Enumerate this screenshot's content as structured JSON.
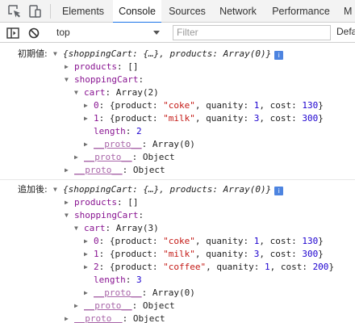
{
  "tabs": [
    "Elements",
    "Console",
    "Sources",
    "Network",
    "Performance",
    "M"
  ],
  "toolbar": {
    "context": "top",
    "filter_placeholder": "Filter",
    "levels": "Defa"
  },
  "icons": {
    "inspect": "inspect-element-icon",
    "device": "device-toolbar-icon",
    "sidebar": "console-sidebar-icon",
    "clear": "clear-console-icon",
    "info": "info-icon"
  },
  "log": [
    {
      "label": "初期値:",
      "lines": [
        {
          "t": "▼",
          "p": [
            [
              "sum",
              "{shoppingCart: {…}, products: Array(0)}"
            ]
          ]
        },
        {
          "t": "▶",
          "p": [
            [
              "key",
              "products"
            ],
            [
              "",
              ": []"
            ]
          ]
        },
        {
          "t": "▼",
          "p": [
            [
              "key",
              "shoppingCart"
            ],
            [
              "",
              ":"
            ]
          ]
        },
        {
          "t": "▼",
          "p": [
            [
              "key",
              "cart"
            ],
            [
              "",
              ": Array(2)"
            ]
          ]
        },
        {
          "t": "▶",
          "p": [
            [
              "key",
              "0"
            ],
            [
              "",
              ": {product: "
            ],
            [
              "str",
              "\"coke\""
            ],
            [
              "",
              ", quanity: "
            ],
            [
              "num",
              "1"
            ],
            [
              "",
              ", cost: "
            ],
            [
              "num",
              "130"
            ],
            [
              "",
              "}"
            ]
          ]
        },
        {
          "t": "▶",
          "p": [
            [
              "key",
              "1"
            ],
            [
              "",
              ": {product: "
            ],
            [
              "str",
              "\"milk\""
            ],
            [
              "",
              ", quanity: "
            ],
            [
              "num",
              "3"
            ],
            [
              "",
              ", cost: "
            ],
            [
              "num",
              "300"
            ],
            [
              "",
              "}"
            ]
          ]
        },
        {
          "t": "",
          "p": [
            [
              "key",
              "length"
            ],
            [
              "",
              ": "
            ],
            [
              "num",
              "2"
            ]
          ]
        },
        {
          "t": "▶",
          "p": [
            [
              "proto",
              "__proto__"
            ],
            [
              "",
              ": Array(0)"
            ]
          ]
        },
        {
          "t": "▶",
          "p": [
            [
              "proto",
              "__proto__"
            ],
            [
              "",
              ": Object"
            ]
          ]
        },
        {
          "t": "▶",
          "p": [
            [
              "proto",
              "__proto__"
            ],
            [
              "",
              ": Object"
            ]
          ]
        }
      ]
    },
    {
      "label": "追加後:",
      "lines": [
        {
          "t": "▼",
          "p": [
            [
              "sum",
              "{shoppingCart: {…}, products: Array(0)}"
            ]
          ]
        },
        {
          "t": "▶",
          "p": [
            [
              "key",
              "products"
            ],
            [
              "",
              ": []"
            ]
          ]
        },
        {
          "t": "▼",
          "p": [
            [
              "key",
              "shoppingCart"
            ],
            [
              "",
              ":"
            ]
          ]
        },
        {
          "t": "▼",
          "p": [
            [
              "key",
              "cart"
            ],
            [
              "",
              ": Array(3)"
            ]
          ]
        },
        {
          "t": "▶",
          "p": [
            [
              "key",
              "0"
            ],
            [
              "",
              ": {product: "
            ],
            [
              "str",
              "\"coke\""
            ],
            [
              "",
              ", quanity: "
            ],
            [
              "num",
              "1"
            ],
            [
              "",
              ", cost: "
            ],
            [
              "num",
              "130"
            ],
            [
              "",
              "}"
            ]
          ]
        },
        {
          "t": "▶",
          "p": [
            [
              "key",
              "1"
            ],
            [
              "",
              ": {product: "
            ],
            [
              "str",
              "\"milk\""
            ],
            [
              "",
              ", quanity: "
            ],
            [
              "num",
              "3"
            ],
            [
              "",
              ", cost: "
            ],
            [
              "num",
              "300"
            ],
            [
              "",
              "}"
            ]
          ]
        },
        {
          "t": "▶",
          "p": [
            [
              "key",
              "2"
            ],
            [
              "",
              ": {product: "
            ],
            [
              "str",
              "\"coffee\""
            ],
            [
              "",
              ", quanity: "
            ],
            [
              "num",
              "1"
            ],
            [
              "",
              ", cost: "
            ],
            [
              "num",
              "200"
            ],
            [
              "",
              "}"
            ]
          ]
        },
        {
          "t": "",
          "p": [
            [
              "key",
              "length"
            ],
            [
              "",
              ": "
            ],
            [
              "num",
              "3"
            ]
          ]
        },
        {
          "t": "▶",
          "p": [
            [
              "proto",
              "__proto__"
            ],
            [
              "",
              ": Array(0)"
            ]
          ]
        },
        {
          "t": "▶",
          "p": [
            [
              "proto",
              "__proto__"
            ],
            [
              "",
              ": Object"
            ]
          ]
        },
        {
          "t": "▶",
          "p": [
            [
              "proto",
              "__proto__"
            ],
            [
              "",
              ": Object"
            ]
          ]
        }
      ]
    }
  ]
}
